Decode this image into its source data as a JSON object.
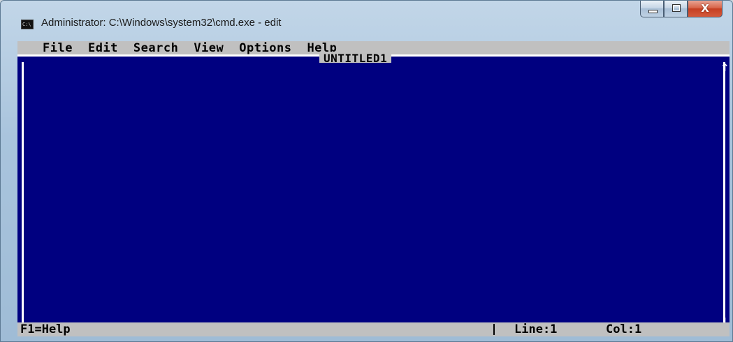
{
  "window": {
    "title": "Administrator: C:\\Windows\\system32\\cmd.exe - edit",
    "icon": "cmd-icon",
    "icon_text": "C:\\",
    "controls": {
      "minimize_icon": "minimize-icon",
      "maximize_icon": "maximize-icon",
      "close_icon": "close-icon",
      "close_glyph": "X"
    }
  },
  "menu": {
    "items": [
      "File",
      "Edit",
      "Search",
      "View",
      "Options",
      "Help"
    ]
  },
  "editor": {
    "document_title": "UNTITLED1",
    "content": "",
    "scroll_up_glyph": "↑",
    "scroll_down_glyph": "↓"
  },
  "status": {
    "help": "F1=Help",
    "line": "Line:1",
    "col": "Col:1"
  },
  "colors": {
    "editor_background": "#000080",
    "chrome_background": "#c0c0c0",
    "frame": "#ffffff"
  }
}
